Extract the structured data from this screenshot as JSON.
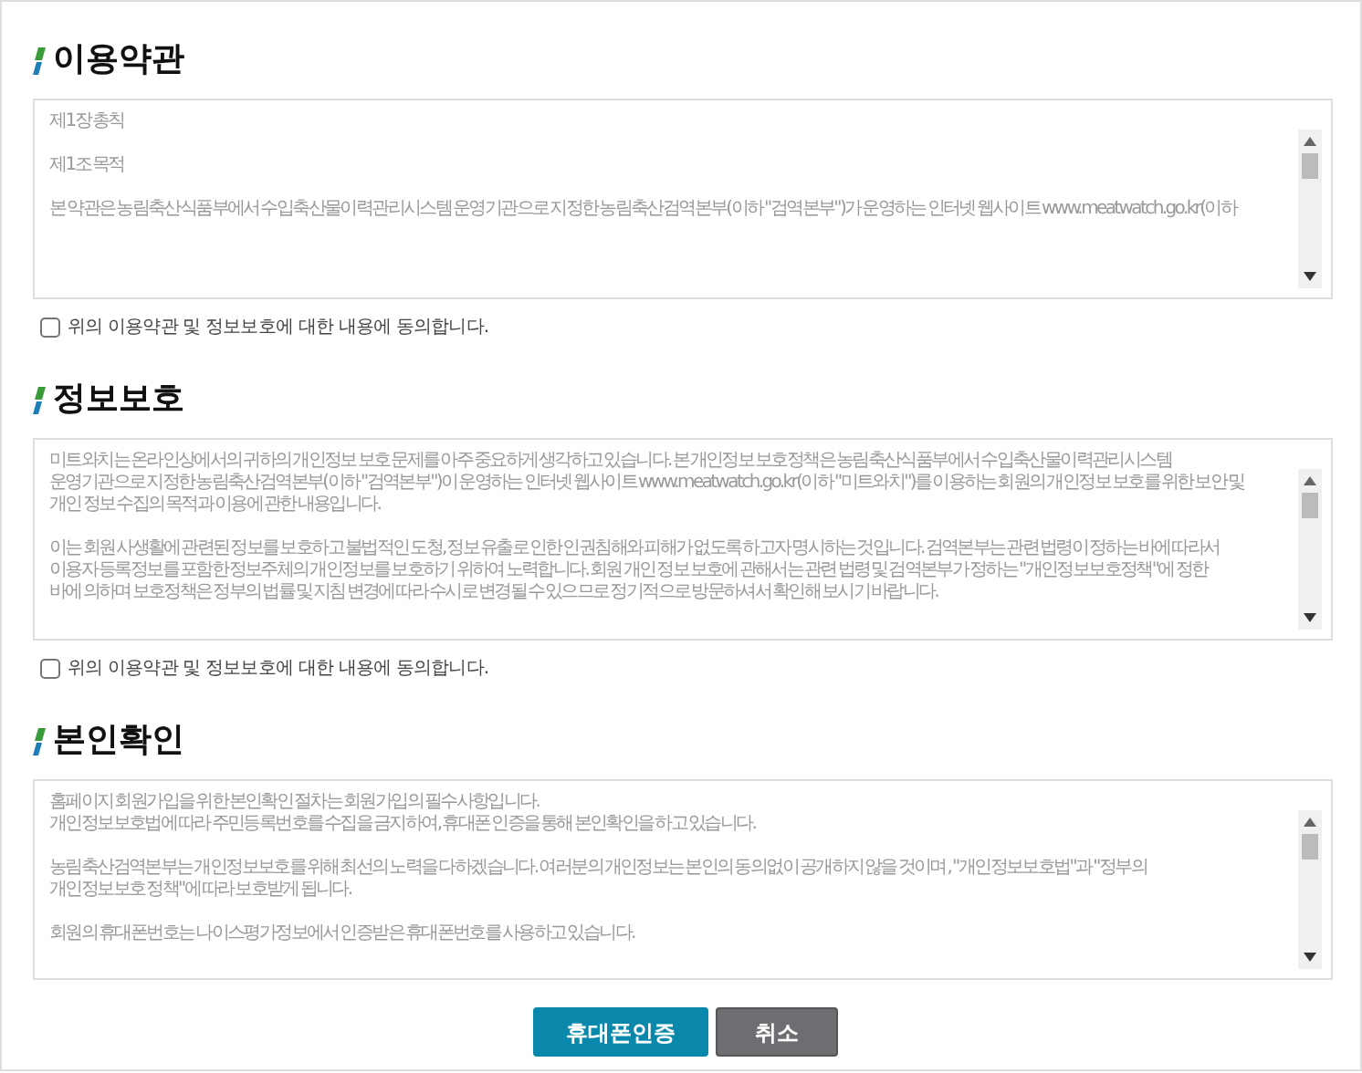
{
  "sections": [
    {
      "title": "이용약관",
      "paragraphs": [
        [
          "제1장 총칙"
        ],
        [
          "제1조 목적"
        ],
        [
          "본 약관은 농림축산식품부에서 수입축산물이력관리시스템 운영기관으로 지정한 농림축산검역본부(이하 \"검역본부\")가 운영하는 인터넷 웹사이트 www.meatwatch.go.kr(이하"
        ]
      ],
      "agree": {
        "label": "위의 이용약관 및 정보보호에 대한 내용에 동의합니다.",
        "checked": false
      }
    },
    {
      "title": "정보보호",
      "paragraphs": [
        [
          "미트와치는 온라인상에서의 귀하의 개인정보 보호 문제를 아주 중요하게 생각하고 있습니다. 본 개인정보 보호정책은 농림축산식품부에서 수입축산물이력관리시스템",
          "운영기관으로 지정한 농림축산검역본부(이하 \"검역본부\")이 운영하는 인터넷 웹사이트 www.meatwatch.go.kr(이하 \"미트와치\")를 이용하는 회원의 개인정보 보호를 위한 보안 및",
          "개인 정보 수집의 목적과 이용에 관한 내용입니다."
        ],
        [
          "이는 회원 사생활에 관련된 정보를 보호하고 불법적인 도청, 정보 유출로 인한 인권침해와 피해가 없도록 하고자 명시하는 것입니다. 검역본부는 관련 법령이 정하는 바에 따라서",
          "이용자 등록정보를 포함한 정보주체의 개인정보를 보호하기 위하여 노력합니다. 회원 개인 정보 보호에 관해서는 관련 법령 및 검역본부가 정하는 \"개인정보보호정책\"에 정한",
          "바에 의하며 보호정책은 정부의 법률 및 지침 변경에 따라 수시로 변경될 수 있으므로 정기적으로 방문하셔서 확인해 보시기 바랍니다."
        ]
      ],
      "agree": {
        "label": "위의 이용약관 및 정보보호에 대한 내용에 동의합니다.",
        "checked": false
      }
    },
    {
      "title": "본인확인",
      "paragraphs": [
        [
          "홈페이지 회원가입을 위한 본인확인 절차는 회원가입의 필수사항입니다.",
          "개인정보보호법에 따라 주민등록번호를 수집을 금지하여, 휴대폰 인증을 통해 본인확인을 하고 있습니다."
        ],
        [
          "농림축산검역본부는 개인정보보호를 위해 최선의 노력을 다하겠습니다. 여러분의 개인정보는 본인의 동의없이 공개하지 않을 것이며 , \"개인정보보호법\"과 \"정부의",
          "개인정보보호 정책\"에 따라 보호받게 됩니다."
        ],
        [
          "회원의 휴대폰번호는 나이스평가정보에서 인증받은 휴대폰번호를 사용하고 있습니다."
        ]
      ]
    }
  ],
  "buttons": [
    {
      "label": "휴대폰인증",
      "kind": "primary"
    },
    {
      "label": "취소",
      "kind": "secondary"
    }
  ]
}
